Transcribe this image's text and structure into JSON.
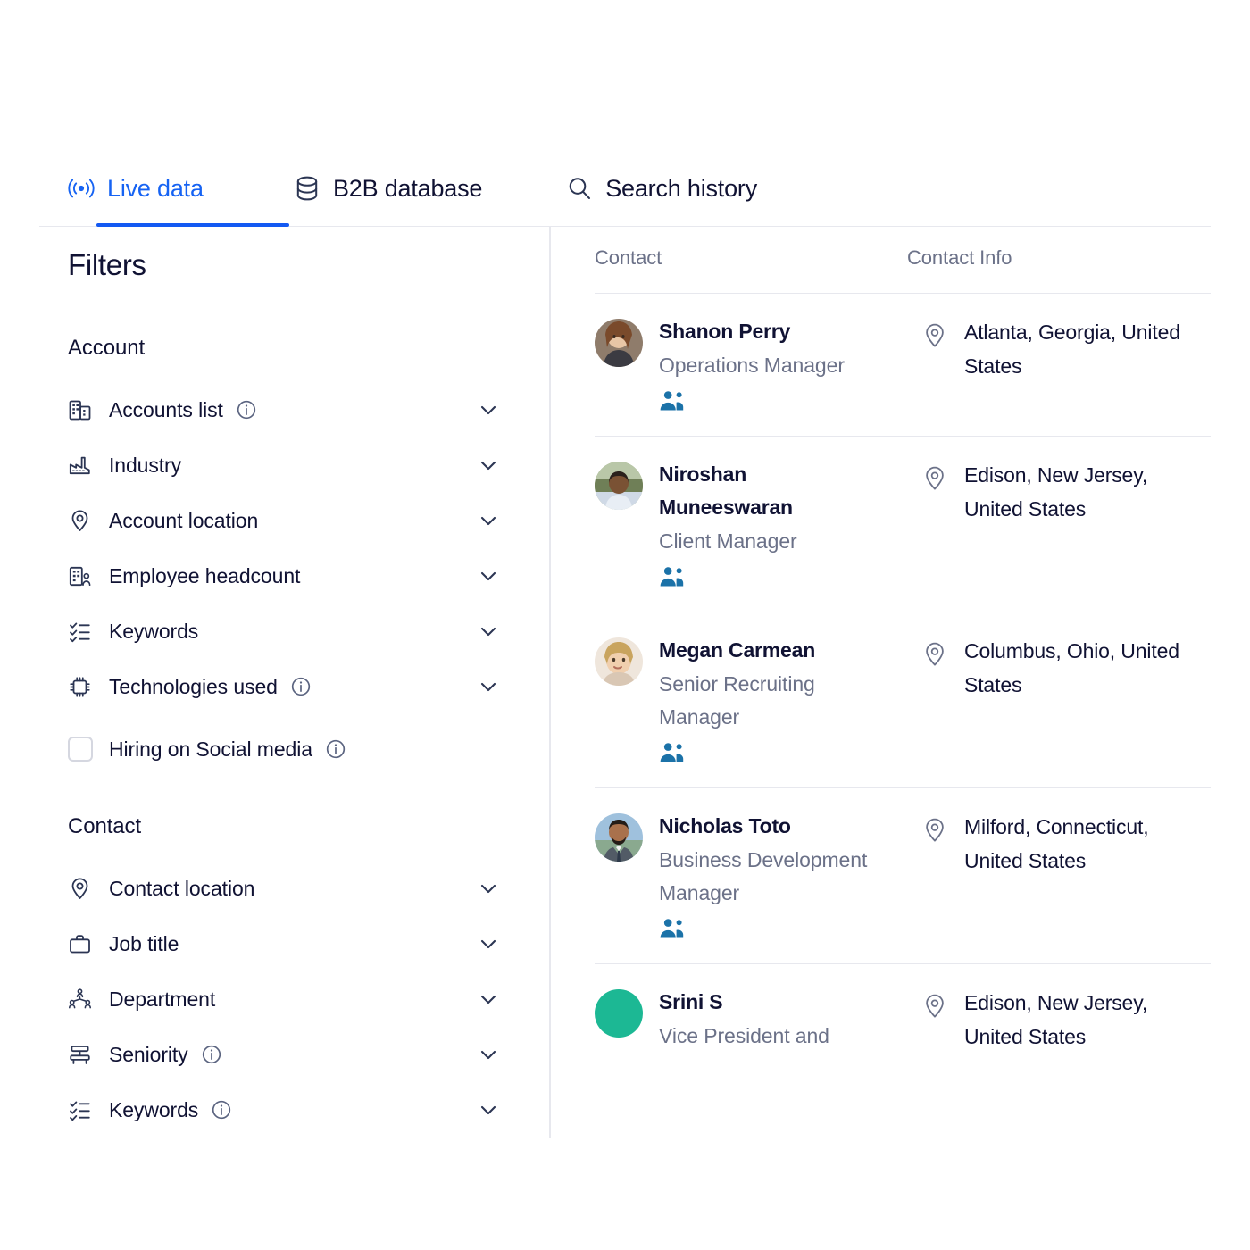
{
  "tabs": [
    {
      "id": "live-data",
      "label": "Live data",
      "icon": "broadcast-icon",
      "active": true
    },
    {
      "id": "b2b-database",
      "label": "B2B database",
      "icon": "database-icon",
      "active": false
    },
    {
      "id": "search-history",
      "label": "Search history",
      "icon": "search-icon",
      "active": false
    }
  ],
  "sidebar": {
    "title": "Filters",
    "groups": [
      {
        "name": "Account",
        "items": [
          {
            "label": "Accounts list",
            "icon": "building-icon",
            "info": true,
            "chevron": true,
            "checkbox": false
          },
          {
            "label": "Industry",
            "icon": "factory-icon",
            "info": false,
            "chevron": true,
            "checkbox": false
          },
          {
            "label": "Account location",
            "icon": "map-pin-icon",
            "info": false,
            "chevron": true,
            "checkbox": false
          },
          {
            "label": "Employee headcount",
            "icon": "building-person-icon",
            "info": false,
            "chevron": true,
            "checkbox": false
          },
          {
            "label": "Keywords",
            "icon": "checklist-icon",
            "info": false,
            "chevron": true,
            "checkbox": false
          },
          {
            "label": "Technologies used",
            "icon": "chip-icon",
            "info": true,
            "chevron": true,
            "checkbox": false
          },
          {
            "label": "Hiring on Social media",
            "icon": "checkbox-icon",
            "info": true,
            "chevron": false,
            "checkbox": true
          }
        ]
      },
      {
        "name": "Contact",
        "items": [
          {
            "label": "Contact location",
            "icon": "map-pin-icon",
            "info": false,
            "chevron": true,
            "checkbox": false
          },
          {
            "label": "Job title",
            "icon": "briefcase-icon",
            "info": false,
            "chevron": true,
            "checkbox": false
          },
          {
            "label": "Department",
            "icon": "org-chart-icon",
            "info": false,
            "chevron": true,
            "checkbox": false
          },
          {
            "label": "Seniority",
            "icon": "throne-icon",
            "info": true,
            "chevron": true,
            "checkbox": false
          },
          {
            "label": "Keywords",
            "icon": "checklist-icon",
            "info": true,
            "chevron": true,
            "checkbox": false
          }
        ]
      }
    ]
  },
  "results": {
    "columns": {
      "contact": "Contact",
      "contact_info": "Contact Info"
    },
    "rows": [
      {
        "name": "Shanon Perry",
        "title": "Operations Manager",
        "location": "Atlanta, Georgia, United States",
        "source_icon": "people-icon",
        "avatar_type": "photo",
        "avatar_colors": [
          "#d8b99a",
          "#c9a484",
          "#8f7c6b"
        ]
      },
      {
        "name": "Niroshan Muneeswaran",
        "title": "Client Manager",
        "location": "Edison, New Jersey, United States",
        "source_icon": "people-icon",
        "avatar_type": "photo",
        "avatar_colors": [
          "#7b8f6a",
          "#5c5044",
          "#b9c7a8"
        ]
      },
      {
        "name": "Megan Carmean",
        "title": "Senior Recruiting Manager",
        "location": "Columbus, Ohio, United States",
        "source_icon": "people-icon",
        "avatar_type": "photo",
        "avatar_colors": [
          "#e3dcd1",
          "#c7a57e",
          "#efe6dc"
        ]
      },
      {
        "name": "Nicholas Toto",
        "title": "Business Development Manager",
        "location": "Milford, Connecticut, United States",
        "source_icon": "people-icon",
        "avatar_type": "photo",
        "avatar_colors": [
          "#9fc1dd",
          "#4a4f58",
          "#7a6150"
        ]
      },
      {
        "name": "Srini S",
        "title": "Vice President and",
        "location": "Edison, New Jersey, United States",
        "source_icon": "none",
        "avatar_type": "initial-blank",
        "avatar_colors": [
          "#1cb894"
        ]
      }
    ]
  },
  "colors": {
    "accent_blue": "#1359f2",
    "text_dark": "#101233",
    "text_muted": "#6b7188",
    "divider": "#e7e8ee",
    "source_icon_blue": "#1b72a8",
    "avatar_green": "#1cb894"
  }
}
